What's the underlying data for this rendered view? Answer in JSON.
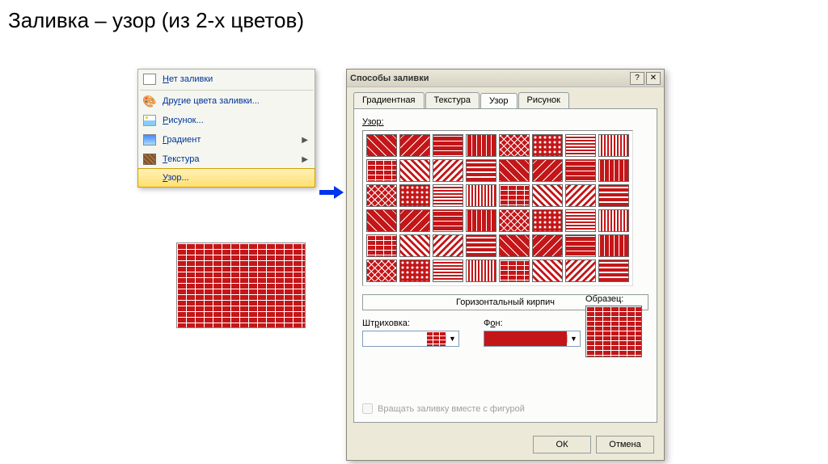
{
  "slide_title": "Заливка – узор (из 2-х цветов)",
  "menu": {
    "items": [
      {
        "label": "Нет заливки",
        "icon": "swatch",
        "submenu": false
      },
      {
        "label": "Другие цвета заливки...",
        "icon": "palette",
        "submenu": false
      },
      {
        "label": "Рисунок...",
        "icon": "picture",
        "submenu": false
      },
      {
        "label": "Градиент",
        "icon": "gradient",
        "submenu": true
      },
      {
        "label": "Текстура",
        "icon": "texture",
        "submenu": true
      },
      {
        "label": "Узор...",
        "icon": "",
        "submenu": false,
        "highlighted": true
      }
    ]
  },
  "dialog": {
    "title": "Способы заливки",
    "tabs": [
      "Градиентная",
      "Текстура",
      "Узор",
      "Рисунок"
    ],
    "active_tab": "Узор",
    "pattern_label": "Узор:",
    "selected_pattern_name": "Горизонтальный кирпич",
    "hatch_label": "Штриховка:",
    "bg_label": "Фон:",
    "hatch_color": "#c41618",
    "bg_color": "#c41618",
    "sample_label": "Образец:",
    "rotate_label": "Вращать заливку вместе с фигурой",
    "ok": "ОК",
    "cancel": "Отмена",
    "help_glyph": "?",
    "close_glyph": "✕"
  },
  "chart_data": {
    "type": "table",
    "description": "8x6 grid of two-color hatch pattern swatches (foreground=white, background=red #c41618). Page depicts pattern-fill selection UI; grid is illustrative, not numeric data.",
    "rows": 6,
    "cols": 8,
    "selected": "Горизонтальный кирпич",
    "colors": {
      "foreground": "#ffffff",
      "background": "#c41618"
    }
  }
}
